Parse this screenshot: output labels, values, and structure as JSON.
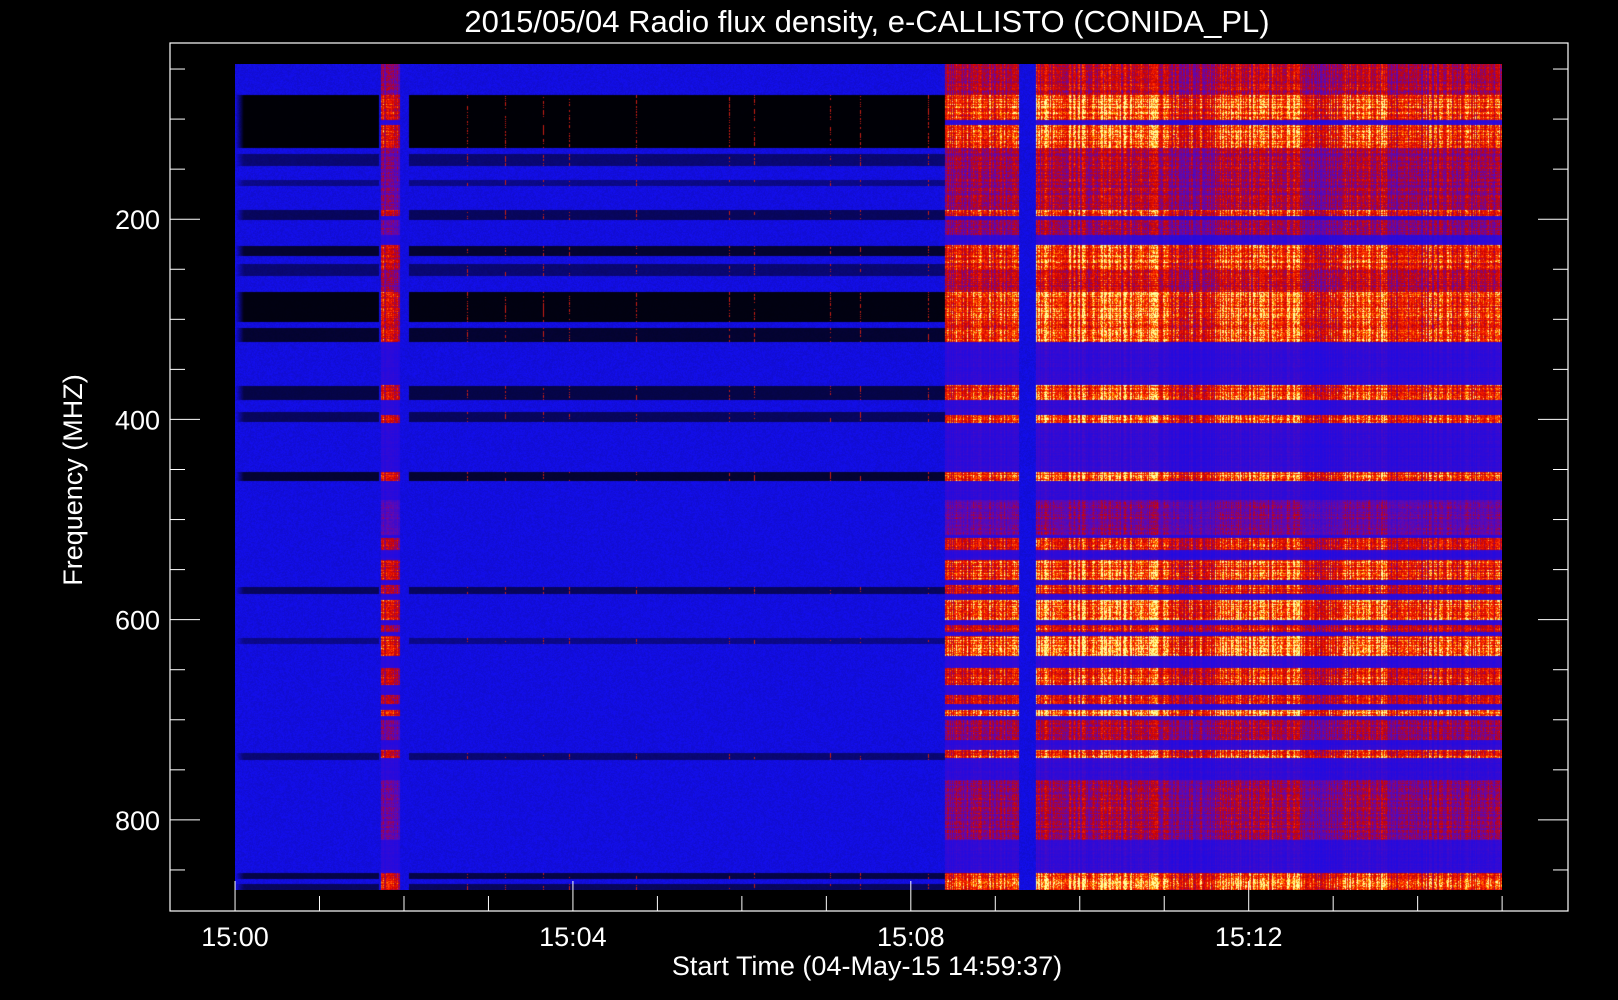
{
  "chart_data": {
    "type": "heatmap",
    "title": "2015/05/04  Radio flux density, e-CALLISTO (CONIDA_PL)",
    "xlabel": "Start Time (04-May-15 14:59:37)",
    "ylabel": "Frequency (MHZ)",
    "x_unit": "minutes after 15:00",
    "xlim": [
      -0.77,
      15.78
    ],
    "ylim": [
      891,
      24
    ],
    "data_time_range": [
      0,
      15
    ],
    "data_freq_range": [
      45,
      870
    ],
    "x_ticks": [
      {
        "value": 0,
        "label": "15:00"
      },
      {
        "value": 4,
        "label": "15:04"
      },
      {
        "value": 8,
        "label": "15:08"
      },
      {
        "value": 12,
        "label": "15:12"
      }
    ],
    "x_minor_step": 1,
    "y_ticks": [
      {
        "value": 200,
        "label": "200"
      },
      {
        "value": 400,
        "label": "400"
      },
      {
        "value": 600,
        "label": "600"
      },
      {
        "value": 800,
        "label": "800"
      }
    ],
    "y_minor_step": 50,
    "colormap": [
      "#000000",
      "#1414f0",
      "#6a10b0",
      "#c00000",
      "#ff3000",
      "#ffa000",
      "#ffff60"
    ],
    "quiet_dark_bands": [
      [
        75,
        128,
        1.0
      ],
      [
        134,
        146,
        0.5
      ],
      [
        160,
        166,
        0.4
      ],
      [
        190,
        200,
        0.6
      ],
      [
        226,
        236,
        0.8
      ],
      [
        244,
        256,
        0.5
      ],
      [
        272,
        302,
        0.95
      ],
      [
        308,
        322,
        0.8
      ],
      [
        366,
        380,
        0.7
      ],
      [
        392,
        402,
        0.6
      ],
      [
        452,
        461,
        0.8
      ],
      [
        567,
        574,
        0.6
      ],
      [
        618,
        624,
        0.4
      ],
      [
        733,
        740,
        0.5
      ],
      [
        853,
        859,
        0.7
      ],
      [
        864,
        870,
        0.6
      ]
    ],
    "active_bands": [
      [
        45,
        75,
        0.55
      ],
      [
        75,
        100,
        0.95
      ],
      [
        105,
        128,
        0.95
      ],
      [
        128,
        190,
        0.5
      ],
      [
        190,
        196,
        0.85
      ],
      [
        200,
        215,
        0.45
      ],
      [
        225,
        250,
        0.85
      ],
      [
        250,
        272,
        0.6
      ],
      [
        272,
        322,
        0.9
      ],
      [
        365,
        380,
        0.85
      ],
      [
        395,
        403,
        0.9
      ],
      [
        452,
        461,
        0.95
      ],
      [
        480,
        515,
        0.35
      ],
      [
        518,
        530,
        0.8
      ],
      [
        540,
        560,
        0.9
      ],
      [
        565,
        574,
        0.75
      ],
      [
        580,
        600,
        1.0
      ],
      [
        605,
        612,
        0.7
      ],
      [
        616,
        636,
        1.0
      ],
      [
        648,
        665,
        0.8
      ],
      [
        675,
        684,
        0.65
      ],
      [
        690,
        696,
        0.95
      ],
      [
        700,
        720,
        0.5
      ],
      [
        730,
        738,
        0.85
      ],
      [
        760,
        820,
        0.45
      ],
      [
        853,
        870,
        0.95
      ]
    ],
    "burst_periods": [
      [
        1.72,
        1.95,
        0.7
      ],
      [
        8.4,
        9.28,
        0.85
      ],
      [
        9.48,
        11.05,
        1.0
      ],
      [
        11.05,
        11.6,
        0.75
      ],
      [
        11.6,
        12.65,
        1.0
      ],
      [
        12.65,
        13.1,
        0.75
      ],
      [
        13.1,
        13.65,
        0.95
      ],
      [
        13.65,
        14.1,
        0.75
      ],
      [
        14.1,
        15.0,
        0.85
      ]
    ],
    "quiet_spikes": [
      2.75,
      3.2,
      3.65,
      3.95,
      4.75,
      5.85,
      6.15,
      7.05,
      7.4,
      8.2
    ]
  }
}
